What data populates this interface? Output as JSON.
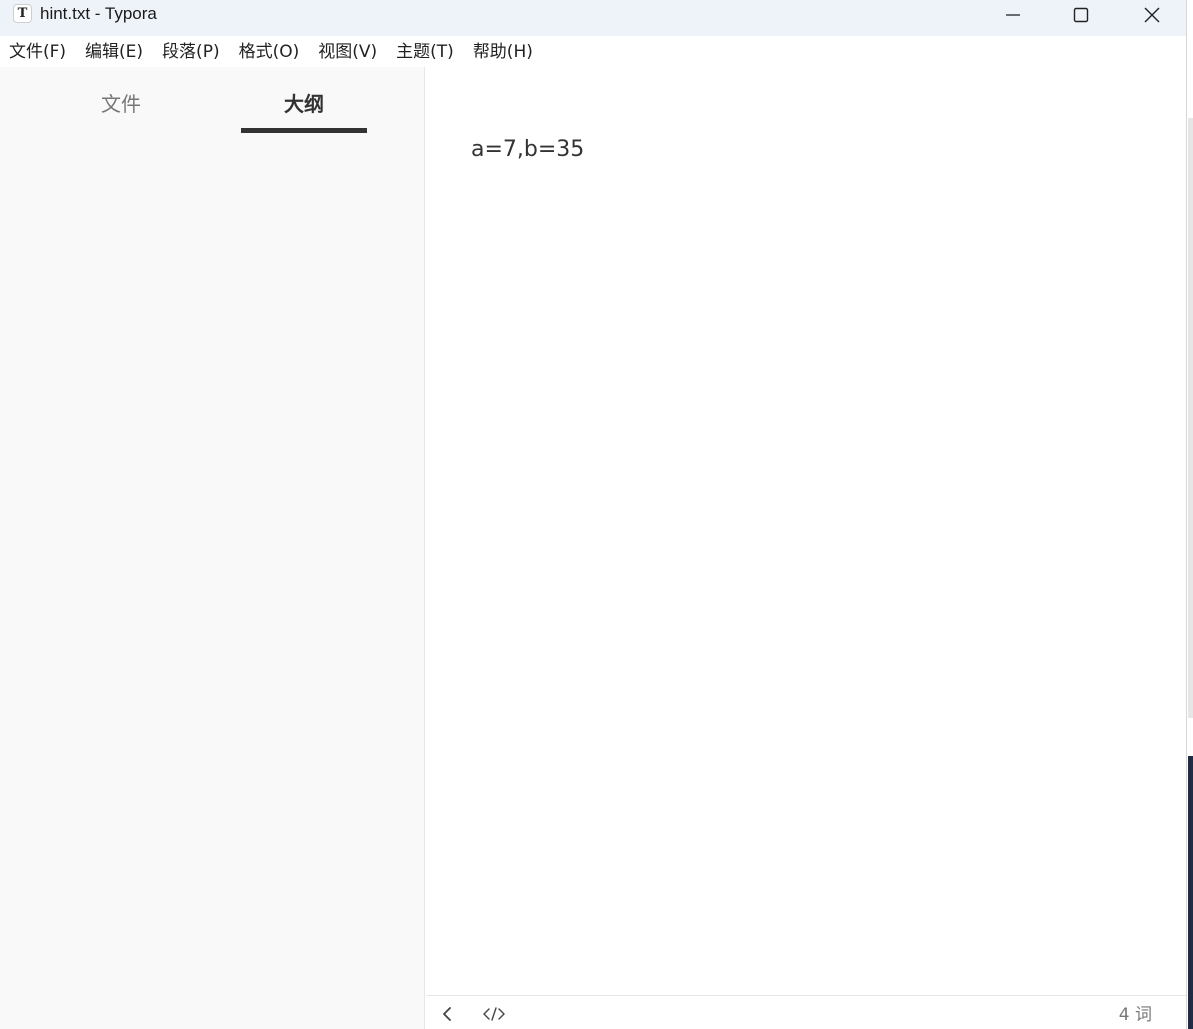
{
  "window": {
    "title": "hint.txt - Typora",
    "app_icon_glyph": "T"
  },
  "menu": [
    {
      "label": "文件(F)"
    },
    {
      "label": "编辑(E)"
    },
    {
      "label": "段落(P)"
    },
    {
      "label": "格式(O)"
    },
    {
      "label": "视图(V)"
    },
    {
      "label": "主题(T)"
    },
    {
      "label": "帮助(H)"
    }
  ],
  "sidebar": {
    "tabs": {
      "files": "文件",
      "outline": "大纲"
    },
    "active_tab": "outline"
  },
  "editor": {
    "content": "a=7,b=35"
  },
  "statusbar": {
    "word_count": "4 词",
    "icons": [
      "chevron-left-icon",
      "source-code-icon"
    ]
  },
  "colors": {
    "titlebar_bg": "#eef3fa",
    "sidebar_bg": "#f9f9f9",
    "text": "#333333",
    "muted_text": "#777777"
  }
}
